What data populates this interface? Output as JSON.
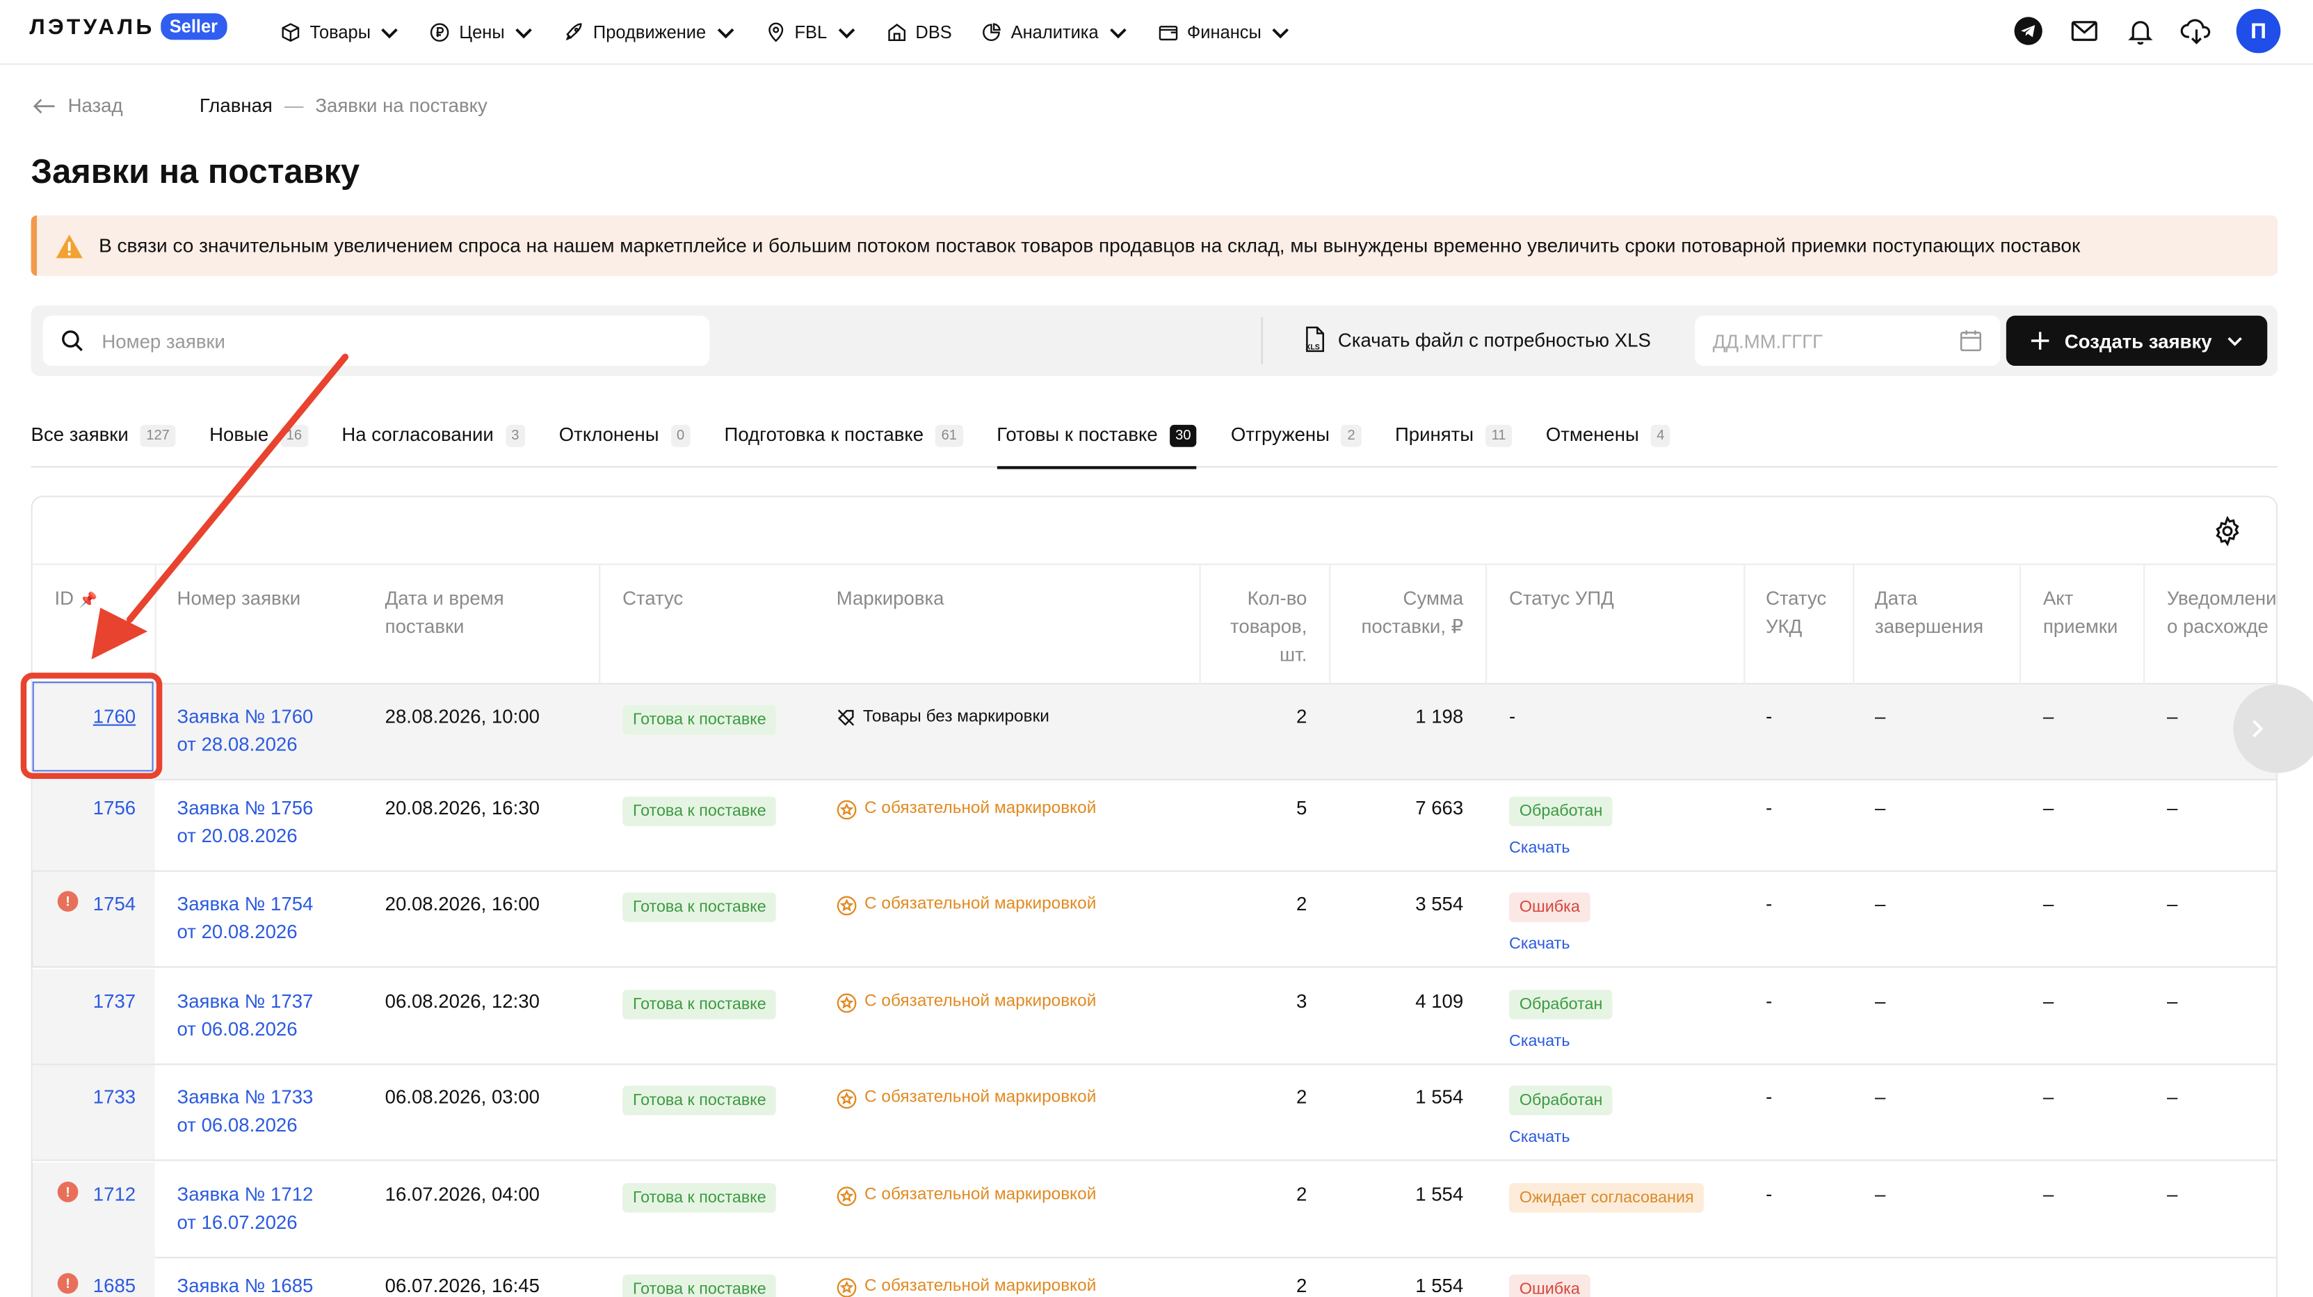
{
  "logo": {
    "text": "ЛЭТУАЛЬ",
    "badge": "Seller"
  },
  "nav": {
    "items": [
      {
        "label": "Товары",
        "icon": "cube-icon",
        "dropdown": true
      },
      {
        "label": "Цены",
        "icon": "ruble-icon",
        "dropdown": true
      },
      {
        "label": "Продвижение",
        "icon": "rocket-icon",
        "dropdown": true
      },
      {
        "label": "FBL",
        "icon": "pin-icon",
        "dropdown": true
      },
      {
        "label": "DBS",
        "icon": "store-icon",
        "dropdown": false
      },
      {
        "label": "Аналитика",
        "icon": "pie-icon",
        "dropdown": true
      },
      {
        "label": "Финансы",
        "icon": "wallet-icon",
        "dropdown": true
      }
    ],
    "avatar": "П"
  },
  "breadcrumb": {
    "back": "Назад",
    "home": "Главная",
    "sep": "—",
    "current": "Заявки на поставку"
  },
  "page_title": "Заявки на поставку",
  "warning": "В связи со значительным увеличением спроса на нашем маркетплейсе и большим потоком поставок товаров продавцов на склад, мы вынуждены временно увеличить сроки потоварной приемки поступающих поставок",
  "toolbar": {
    "search_placeholder": "Номер заявки",
    "download_label": "Скачать файл с потребностью XLS",
    "date_placeholder": "ДД.ММ.ГГГГ",
    "create_label": "Создать заявку"
  },
  "tabs": [
    {
      "label": "Все заявки",
      "count": "127"
    },
    {
      "label": "Новые",
      "count": "16"
    },
    {
      "label": "На согласовании",
      "count": "3"
    },
    {
      "label": "Отклонены",
      "count": "0"
    },
    {
      "label": "Подготовка к поставке",
      "count": "61"
    },
    {
      "label": "Готовы к поставке",
      "count": "30",
      "active": true
    },
    {
      "label": "Отгружены",
      "count": "2"
    },
    {
      "label": "Приняты",
      "count": "11"
    },
    {
      "label": "Отменены",
      "count": "4"
    }
  ],
  "columns": {
    "id": "ID",
    "req": "Номер заявки",
    "dt1": "Дата и время",
    "dt2": "поставки",
    "status": "Статус",
    "mark": "Маркировка",
    "qty1": "Кол-во",
    "qty2": "товаров,",
    "qty3": "шт.",
    "sum1": "Сумма",
    "sum2": "поставки, ₽",
    "upd": "Статус УПД",
    "ukd1": "Статус",
    "ukd2": "УКД",
    "end1": "Дата",
    "end2": "завершения",
    "act1": "Акт",
    "act2": "приемки",
    "notif1": "Уведомлени",
    "notif2": "о расхожде"
  },
  "rows": [
    {
      "id": "1760",
      "req1": "Заявка № 1760",
      "req2": "от 28.08.2026",
      "dt": "28.08.2026, 10:00",
      "status": "Готова к поставке",
      "mark": "Товары без маркировки",
      "qty": "2",
      "sum": "1 198",
      "upd": "-",
      "upd_dl": "",
      "ukd": "-",
      "end": "–",
      "act": "–",
      "notif": "–"
    },
    {
      "id": "1756",
      "req1": "Заявка № 1756",
      "req2": "от 20.08.2026",
      "dt": "20.08.2026, 16:30",
      "status": "Готова к поставке",
      "mark": "С обязательной маркировкой",
      "qty": "5",
      "sum": "7 663",
      "upd": "Обработан",
      "upd_dl": "Скачать",
      "ukd": "-",
      "end": "–",
      "act": "–",
      "notif": "–"
    },
    {
      "id": "1754",
      "req1": "Заявка № 1754",
      "req2": "от 20.08.2026",
      "dt": "20.08.2026, 16:00",
      "status": "Готова к поставке",
      "mark": "С обязательной маркировкой",
      "qty": "2",
      "sum": "3 554",
      "upd": "Ошибка",
      "upd_dl": "Скачать",
      "ukd": "-",
      "end": "–",
      "act": "–",
      "notif": "–"
    },
    {
      "id": "1737",
      "req1": "Заявка № 1737",
      "req2": "от 06.08.2026",
      "dt": "06.08.2026, 12:30",
      "status": "Готова к поставке",
      "mark": "С обязательной маркировкой",
      "qty": "3",
      "sum": "4 109",
      "upd": "Обработан",
      "upd_dl": "Скачать",
      "ukd": "-",
      "end": "–",
      "act": "–",
      "notif": "–"
    },
    {
      "id": "1733",
      "req1": "Заявка № 1733",
      "req2": "от 06.08.2026",
      "dt": "06.08.2026, 03:00",
      "status": "Готова к поставке",
      "mark": "С обязательной маркировкой",
      "qty": "2",
      "sum": "1 554",
      "upd": "Обработан",
      "upd_dl": "Скачать",
      "ukd": "-",
      "end": "–",
      "act": "–",
      "notif": "–"
    },
    {
      "id": "1712",
      "req1": "Заявка № 1712",
      "req2": "от 16.07.2026",
      "dt": "16.07.2026, 04:00",
      "status": "Готова к поставке",
      "mark": "С обязательной маркировкой",
      "qty": "2",
      "sum": "1 554",
      "upd": "Ожидает согласования",
      "upd_dl": "",
      "ukd": "-",
      "end": "–",
      "act": "–",
      "notif": "–"
    },
    {
      "id": "1685",
      "req1": "Заявка № 1685",
      "req2": "",
      "dt": "06.07.2026, 16:45",
      "status": "Готова к поставке",
      "mark": "С обязательной маркировкой",
      "qty": "2",
      "sum": "1 554",
      "upd": "Ошибка",
      "upd_dl": "",
      "ukd": "",
      "end": "",
      "act": "",
      "notif": ""
    }
  ],
  "error_icon": "!",
  "colors": {
    "accent": "#2f5ef0",
    "link": "#2b5ae0",
    "annotation": "#e8432f"
  }
}
